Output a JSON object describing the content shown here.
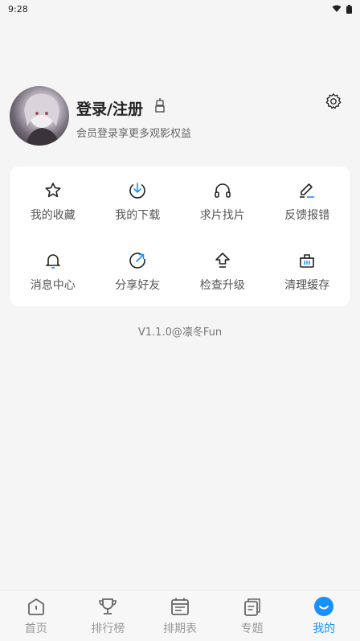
{
  "status_bar": {
    "time": "9:28"
  },
  "profile": {
    "title": "登录/注册",
    "subtitle": "会员登录享更多观影权益"
  },
  "grid": [
    {
      "label": "我的收藏",
      "icon": "star-icon"
    },
    {
      "label": "我的下载",
      "icon": "download-icon"
    },
    {
      "label": "求片找片",
      "icon": "headphones-icon"
    },
    {
      "label": "反馈报错",
      "icon": "edit-icon"
    },
    {
      "label": "消息中心",
      "icon": "bell-icon"
    },
    {
      "label": "分享好友",
      "icon": "share-icon"
    },
    {
      "label": "检查升级",
      "icon": "upgrade-icon"
    },
    {
      "label": "清理缓存",
      "icon": "basket-icon"
    }
  ],
  "version": "V1.1.0@凛冬Fun",
  "tabs": [
    {
      "label": "首页",
      "icon": "home-icon"
    },
    {
      "label": "排行榜",
      "icon": "trophy-icon"
    },
    {
      "label": "排期表",
      "icon": "calendar-icon"
    },
    {
      "label": "专题",
      "icon": "topic-icon"
    },
    {
      "label": "我的",
      "icon": "me-icon",
      "active": true
    }
  ],
  "colors": {
    "accent": "#1890ff"
  }
}
